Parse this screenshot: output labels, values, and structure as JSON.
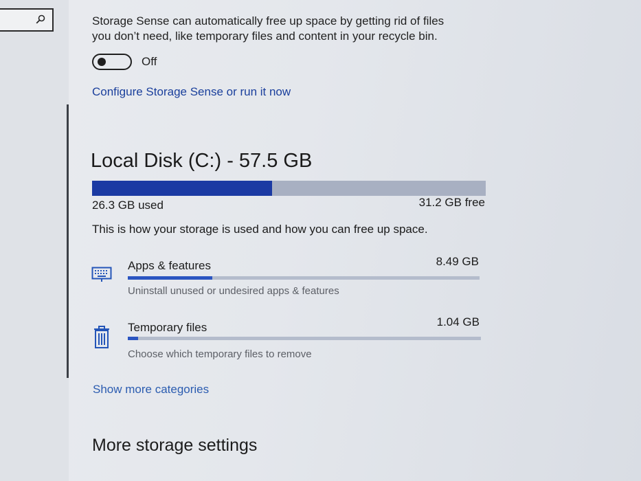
{
  "storage_sense": {
    "description_line1": "Storage Sense can automatically free up space by getting rid of files",
    "description_line2": "you don’t need, like temporary files and content in your recycle bin.",
    "toggle_state_label": "Off",
    "toggle_on": false,
    "configure_link": "Configure Storage Sense or run it now"
  },
  "disk": {
    "title": "Local Disk (C:) - 57.5 GB",
    "used_label": "26.3 GB used",
    "free_label": "31.2 GB free",
    "used_fraction": 0.457,
    "bar_used_color": "#1b3aa3",
    "bar_free_color": "#a8b0c2"
  },
  "usage_description": "This is how your storage is used and how you can free up space.",
  "categories": [
    {
      "icon": "keyboard-icon",
      "title": "Apps & features",
      "size": "8.49 GB",
      "subtitle": "Uninstall unused or undesired apps & features",
      "fraction": 0.24
    },
    {
      "icon": "trash-icon",
      "title": "Temporary files",
      "size": "1.04 GB",
      "subtitle": "Choose which temporary files to remove",
      "fraction": 0.03
    }
  ],
  "show_more_link": "Show more categories",
  "more_settings_title": "More storage settings",
  "colors": {
    "accent": "#1b3aa3",
    "link": "#1a3f9c"
  }
}
